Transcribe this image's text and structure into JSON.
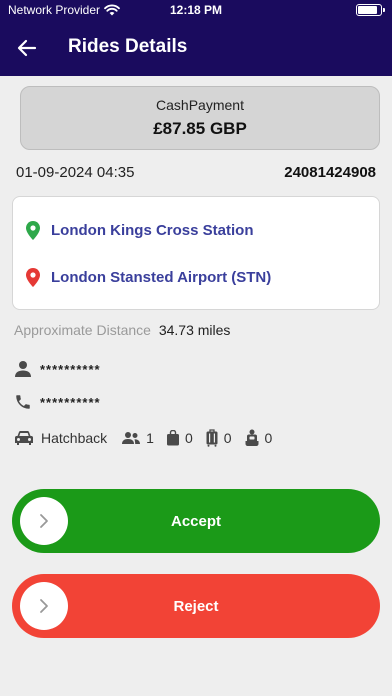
{
  "status_bar": {
    "carrier": "Network Provider",
    "time": "12:18 PM"
  },
  "header": {
    "title": "Rides Details"
  },
  "payment": {
    "method": "CashPayment",
    "amount": "£87.85 GBP"
  },
  "ride": {
    "datetime": "01-09-2024 04:35",
    "id": "24081424908"
  },
  "route": {
    "pickup": "London Kings Cross Station",
    "dropoff": "London Stansted Airport (STN)",
    "pickup_color": "#2ea84a",
    "dropoff_color": "#e53935"
  },
  "distance": {
    "label": "Approximate Distance",
    "value": "34.73 miles"
  },
  "passenger": {
    "name": "**********",
    "phone": "**********"
  },
  "vehicle": {
    "type": "Hatchback",
    "passengers": "1",
    "hand_luggage": "0",
    "suitcases": "0",
    "child_seats": "0"
  },
  "actions": {
    "accept_label": "Accept",
    "reject_label": "Reject",
    "accept_color": "#1b9a18",
    "reject_color": "#f24336"
  },
  "colors": {
    "header_bg": "#1a0b5e",
    "page_bg": "#eeeeee"
  },
  "icons": [
    "wifi-icon",
    "battery-icon",
    "back-arrow-icon",
    "map-pin-icon",
    "person-icon",
    "phone-icon",
    "car-icon",
    "group-icon",
    "bag-icon",
    "suitcase-icon",
    "child-seat-icon",
    "chevron-right-icon"
  ]
}
